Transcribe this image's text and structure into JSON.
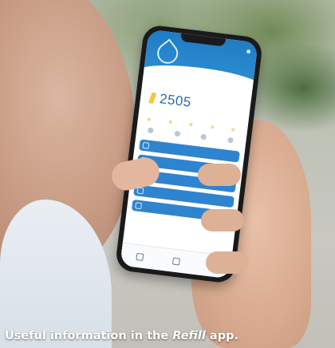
{
  "caption": {
    "before": "Useful information in the ",
    "emphasis": "Refill",
    "after": " app."
  },
  "app": {
    "counter_value": "2505",
    "menu_items": [
      {
        "icon": "chat-icon"
      },
      {
        "icon": "wifi-icon"
      },
      {
        "icon": "info-icon"
      },
      {
        "icon": "search-icon"
      },
      {
        "icon": "profile-icon"
      }
    ],
    "tab_icons": [
      "home-icon",
      "refill-icon",
      "account-icon"
    ],
    "accent": "#2f84cf",
    "highlight": "#f2c83e"
  }
}
